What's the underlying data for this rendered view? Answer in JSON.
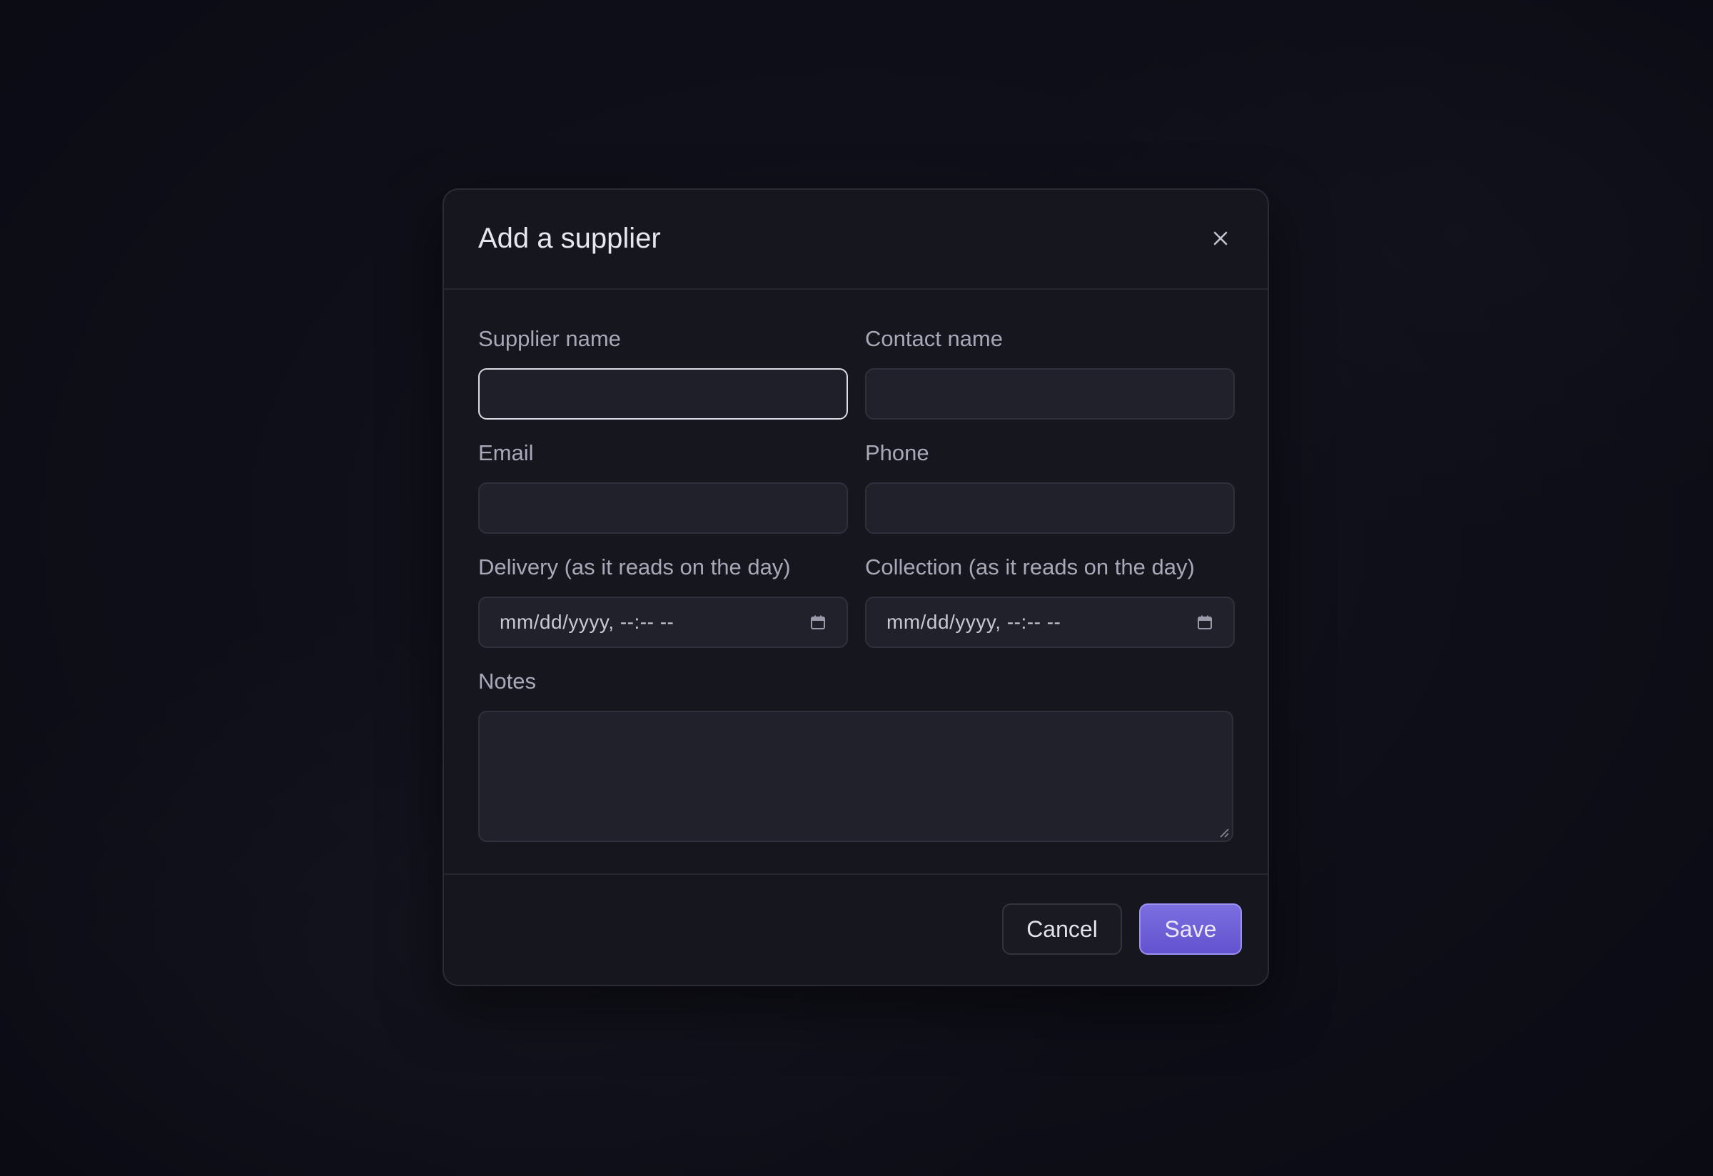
{
  "dialog": {
    "title": "Add a supplier",
    "close_icon": "close-icon"
  },
  "fields": {
    "supplier_name": {
      "label": "Supplier name",
      "value": "",
      "focused": true
    },
    "contact_name": {
      "label": "Contact name",
      "value": ""
    },
    "email": {
      "label": "Email",
      "value": ""
    },
    "phone": {
      "label": "Phone",
      "value": ""
    },
    "delivery": {
      "label": "Delivery (as it reads on the day)",
      "placeholder": "mm/dd/yyyy, --:-- --",
      "icon": "calendar-icon"
    },
    "collection": {
      "label": "Collection (as it reads on the day)",
      "placeholder": "mm/dd/yyyy, --:-- --",
      "icon": "calendar-icon"
    },
    "notes": {
      "label": "Notes",
      "value": ""
    }
  },
  "footer": {
    "cancel_label": "Cancel",
    "save_label": "Save"
  },
  "colors": {
    "accent": "#6c5ce0",
    "background": "#0f0f19",
    "surface": "#16161f",
    "input": "#21212b"
  }
}
